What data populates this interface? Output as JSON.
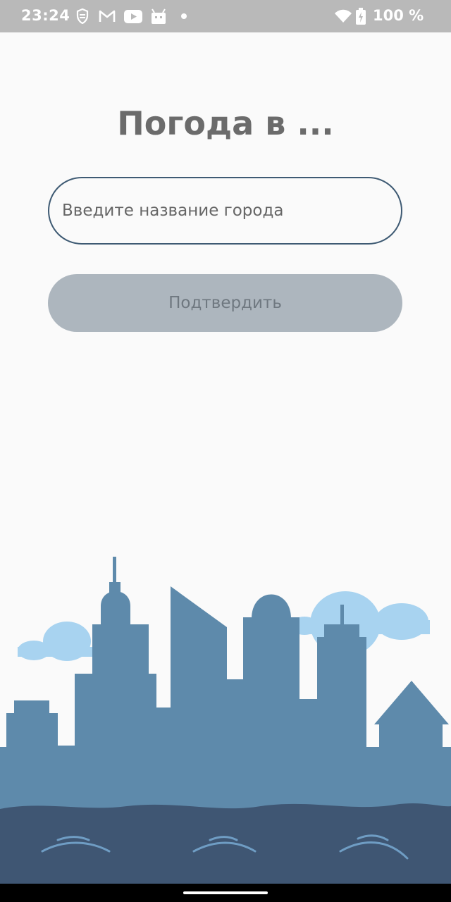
{
  "status_bar": {
    "time": "23:24",
    "battery_percent": "100 %",
    "notification_icons": [
      "shield-icon",
      "gmail-icon",
      "youtube-icon",
      "android-icon",
      "dot-icon"
    ],
    "system_icons": [
      "wifi-icon",
      "battery-charging-icon"
    ]
  },
  "main": {
    "title": "Погода в ...",
    "city_input": {
      "value": "",
      "placeholder": "Введите название города"
    },
    "confirm_label": "Подтвердить"
  },
  "illustration": {
    "name": "city-skyline-illustration",
    "colors": {
      "buildings": "#5e8aab",
      "clouds": "#a8d3f0",
      "water": "#3f5673",
      "waves": "#6f9dc4"
    }
  },
  "colors": {
    "background": "#fafafa",
    "input_border": "#3e5a73",
    "button_bg": "#adb6be",
    "button_text": "#6f7880",
    "title": "#6b6b6b"
  }
}
